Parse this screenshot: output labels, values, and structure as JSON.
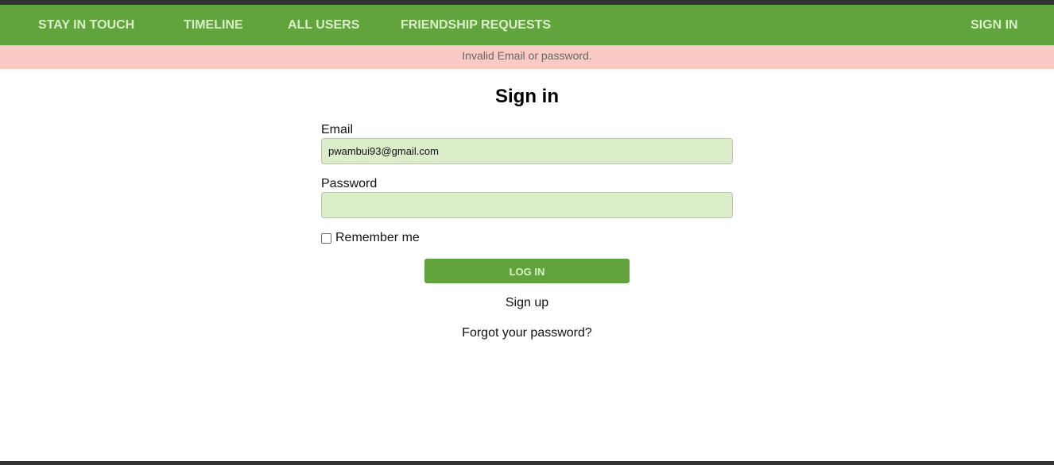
{
  "nav": {
    "brand": "STAY IN TOUCH",
    "items": [
      "TIMELINE",
      "ALL USERS",
      "FRIENDSHIP REQUESTS"
    ],
    "sign_in": "SIGN IN"
  },
  "alert": {
    "message": "Invalid Email or password."
  },
  "form": {
    "title": "Sign in",
    "email_label": "Email",
    "email_value": "pwambui93@gmail.com",
    "password_label": "Password",
    "password_value": "",
    "remember_label": "Remember me",
    "remember_checked": false,
    "submit_label": "LOG IN",
    "signup_link": "Sign up",
    "forgot_link": "Forgot your password?"
  },
  "colors": {
    "nav_bg": "#61a33d",
    "nav_text": "#d8efc7",
    "alert_bg": "#facbc5",
    "input_bg": "#dbedc9"
  }
}
